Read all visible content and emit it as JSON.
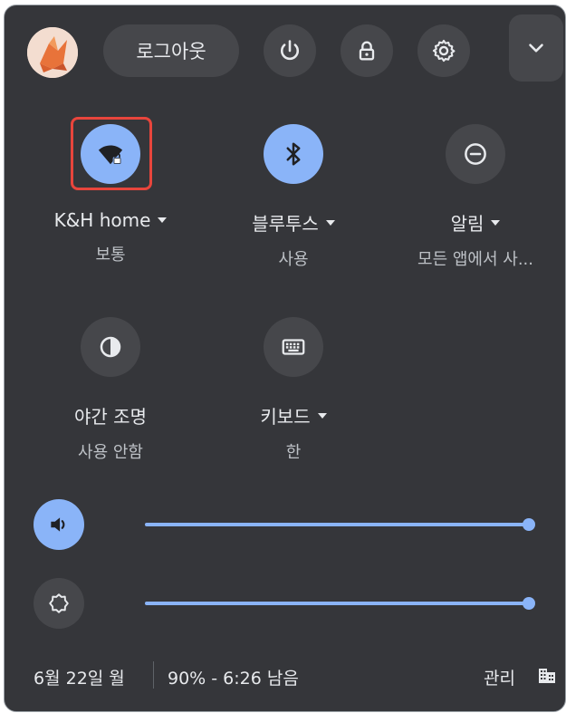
{
  "header": {
    "sign_out_label": "로그아웃",
    "buttons": [
      "power-icon",
      "lock-icon",
      "gear-icon",
      "chevron-down-icon"
    ]
  },
  "tiles": [
    {
      "label": "K&H home",
      "sub": "보통",
      "state": "on",
      "icon": "wifi-locked-icon",
      "has_menu": true
    },
    {
      "label": "블루투스",
      "sub": "사용",
      "state": "on",
      "icon": "bluetooth-icon",
      "has_menu": true
    },
    {
      "label": "알림",
      "sub": "모든 앱에서 사...",
      "state": "off",
      "icon": "do-not-disturb-icon",
      "has_menu": true
    },
    {
      "label": "야간 조명",
      "sub": "사용 안함",
      "state": "off",
      "icon": "night-light-icon",
      "has_menu": false
    },
    {
      "label": "키보드",
      "sub": "한",
      "state": "off",
      "icon": "keyboard-icon",
      "has_menu": true
    }
  ],
  "sliders": {
    "volume": {
      "value": 1.0,
      "icon": "volume-icon"
    },
    "brightness": {
      "value": 1.0,
      "icon": "brightness-icon"
    }
  },
  "footer": {
    "date": "6월 22일 월",
    "battery": "90% - 6:26 남음",
    "manage": "관리",
    "icon": "enterprise-building-icon"
  },
  "colors": {
    "panel_bg": "#35363a",
    "button_bg": "#46474b",
    "accent": "#8ab4f8",
    "text": "#e8eaed",
    "highlight": "#e8453c"
  }
}
